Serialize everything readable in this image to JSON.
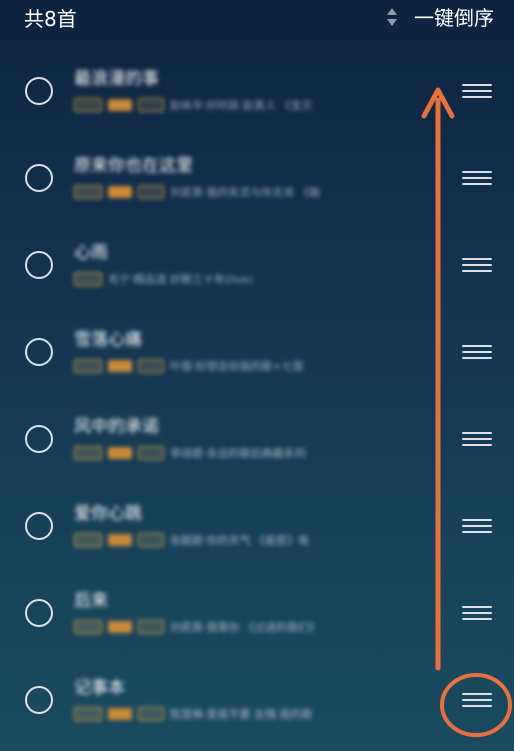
{
  "header": {
    "count_label": "共8首",
    "sort_label": "一键倒序",
    "sort_icon": "sort-updown-icon"
  },
  "songs": [
    {
      "title": "最浪漫的事",
      "meta": "赵咏华·好时辰·赵英人 《宝贝"
    },
    {
      "title": "原来你也在这里",
      "meta": "刘若英·我的失恋与你无关 《路"
    },
    {
      "title": "心雨",
      "meta": "毛宁·精品选 好歌三十年(live)"
    },
    {
      "title": "雪落心痛",
      "meta": "叶蓓·好想念你我的歌+七首"
    },
    {
      "title": "风中的承诺",
      "meta": "李翊君·永远的歌后典藏系列"
    },
    {
      "title": "爱你心跳",
      "meta": "张靓颖·你的天气 《星愿》电"
    },
    {
      "title": "后来",
      "meta": "刘若英·我等你 《过滤的我们》"
    },
    {
      "title": "记事本",
      "meta": "陈慧琳·爱我不要 友情·我的歌"
    }
  ],
  "annotation": {
    "arrow_color": "#e8723d",
    "highlight_color": "#e8723d"
  }
}
